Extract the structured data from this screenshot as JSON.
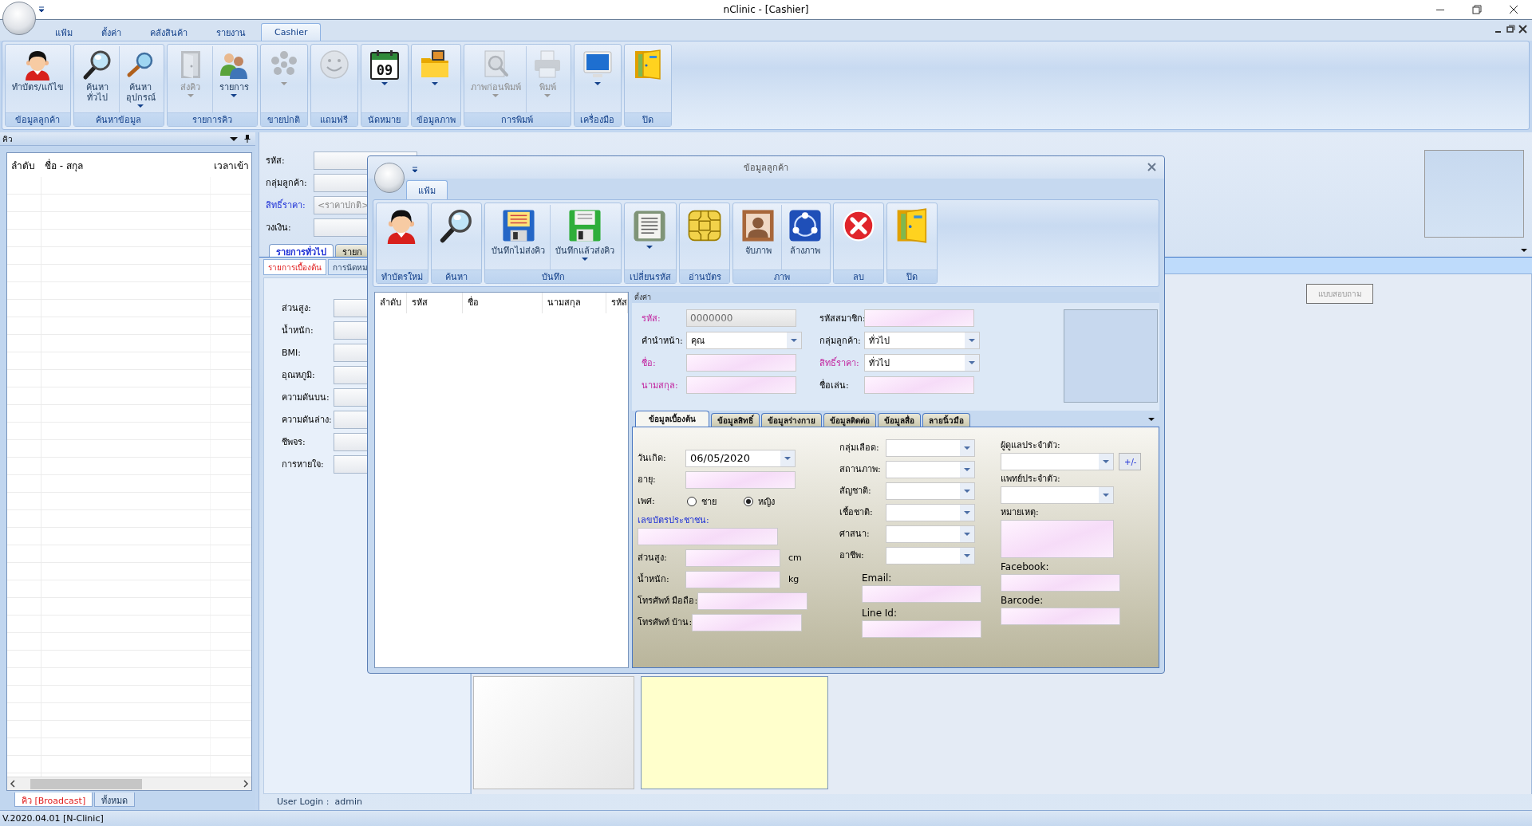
{
  "window": {
    "title": "nClinic - [Cashier]"
  },
  "menu_tabs": [
    {
      "label": "แฟ้ม",
      "selected": false
    },
    {
      "label": "ตั้งค่า",
      "selected": false
    },
    {
      "label": "คลังสินค้า",
      "selected": false
    },
    {
      "label": "รายงาน",
      "selected": false
    },
    {
      "label": "Cashier",
      "selected": true
    }
  ],
  "ribbon": [
    {
      "label": "ข้อมูลลูกค้า",
      "buttons": [
        {
          "kind": "person",
          "label": "ทำบัตร/แก้ไข",
          "disabled": false,
          "dropdown": false
        }
      ]
    },
    {
      "label": "ค้นหาข้อมูล",
      "buttons": [
        {
          "kind": "search",
          "label": "ค้นหา\nทั่วไป",
          "disabled": false,
          "dropdown": false
        },
        {
          "kind": "search_small",
          "label": "ค้นหา\nอุปกรณ์",
          "disabled": false,
          "dropdown": true
        }
      ]
    },
    {
      "label": "รายการคิว",
      "buttons": [
        {
          "kind": "cabinet",
          "label": "ส่งคิว",
          "disabled": true,
          "dropdown": true
        },
        {
          "kind": "people",
          "label": "รายการ",
          "disabled": false,
          "dropdown": true
        }
      ]
    },
    {
      "label": "ขายปกติ",
      "buttons": [
        {
          "kind": "dots",
          "disabled": true,
          "dropdown": true
        }
      ]
    },
    {
      "label": "แถมฟรี",
      "buttons": [
        {
          "kind": "smiley",
          "disabled": true,
          "dropdown": false
        }
      ]
    },
    {
      "label": "นัดหมาย",
      "buttons": [
        {
          "kind": "calendar",
          "day": "09",
          "disabled": false,
          "dropdown": true
        }
      ]
    },
    {
      "label": "ข้อมูลภาพ",
      "buttons": [
        {
          "kind": "folder",
          "disabled": false,
          "dropdown": true
        }
      ]
    },
    {
      "label": "การพิมพ์",
      "buttons": [
        {
          "kind": "preview",
          "label": "ภาพก่อนพิมพ์",
          "disabled": true,
          "dropdown": true
        },
        {
          "kind": "printer",
          "label": "พิมพ์",
          "disabled": true,
          "dropdown": true
        }
      ]
    },
    {
      "label": "เครื่องมือ",
      "buttons": [
        {
          "kind": "monitor",
          "disabled": false,
          "dropdown": true
        }
      ]
    },
    {
      "label": "ปิด",
      "buttons": [
        {
          "kind": "exit",
          "disabled": false,
          "dropdown": false
        }
      ]
    }
  ],
  "queue_panel": {
    "title": "คิว",
    "columns": [
      "ลำดับ",
      "ชื่อ - สกุล",
      "เวลาเข้า"
    ],
    "tabs": [
      {
        "label": "คิว [Broadcast]",
        "selected": true
      },
      {
        "label": "ทั้งหมด",
        "selected": false
      }
    ]
  },
  "customer_form": {
    "fields": [
      {
        "label": "รหัส:",
        "link": false
      },
      {
        "label": "กลุ่มลูกค้า:",
        "link": false
      },
      {
        "label": "สิทธิ์ราคา:",
        "link": true,
        "placeholder": "<ราคาปกติ>"
      },
      {
        "label": "วงเงิน:",
        "link": false
      }
    ]
  },
  "main_tabs": [
    {
      "label": "รายการทั่วไป",
      "selected": true
    },
    {
      "label": "รายก",
      "selected": false
    }
  ],
  "sub_tabs": [
    {
      "label": "รายการเบื้องต้น",
      "selected": true
    },
    {
      "label": "การนัดหม",
      "selected": false
    }
  ],
  "vitals": [
    "ส่วนสูง:",
    "น้ำหนัก:",
    "BMI:",
    "อุณหภูมิ:",
    "ความดันบน:",
    "ความดันล่าง:",
    "ชีพจร:",
    "การหายใจ:"
  ],
  "questionnaire_button": {
    "label": "แบบสอบถาม",
    "disabled": true
  },
  "user_login": "User Login :  admin",
  "status_bar": "V.2020.04.01 [N-Clinic]",
  "dialog": {
    "title": "ข้อมูลลูกค้า",
    "tabs": [
      {
        "label": "แฟ้ม",
        "selected": true
      }
    ],
    "ribbon": [
      {
        "label": "ทำบัตรใหม่",
        "buttons": [
          {
            "kind": "person",
            "disabled": false,
            "dropdown": false
          }
        ]
      },
      {
        "label": "ค้นหา",
        "buttons": [
          {
            "kind": "search",
            "disabled": false,
            "dropdown": false
          }
        ]
      },
      {
        "label": "บันทึก",
        "buttons": [
          {
            "kind": "floppy_blue",
            "label": "บันทึกไม่ส่งคิว",
            "disabled": false,
            "dropdown": false
          },
          {
            "kind": "floppy_green",
            "label": "บันทึกแล้วส่งคิว",
            "disabled": false,
            "dropdown": true
          }
        ]
      },
      {
        "label": "เปลี่ยนรหัส",
        "buttons": [
          {
            "kind": "document",
            "disabled": false,
            "dropdown": true
          }
        ]
      },
      {
        "label": "อ่านบัตร",
        "buttons": [
          {
            "kind": "chip",
            "disabled": false,
            "dropdown": false
          }
        ]
      },
      {
        "label": "ภาพ",
        "buttons": [
          {
            "kind": "portrait",
            "label": "จับภาพ",
            "disabled": false,
            "dropdown": false
          },
          {
            "kind": "network",
            "label": "ล้างภาพ",
            "disabled": false,
            "dropdown": false
          }
        ]
      },
      {
        "label": "ลบ",
        "buttons": [
          {
            "kind": "delete",
            "disabled": false,
            "dropdown": false
          }
        ]
      },
      {
        "label": "ปิด",
        "buttons": [
          {
            "kind": "exit",
            "disabled": false,
            "dropdown": false
          }
        ]
      }
    ],
    "list_columns": [
      "ลำดับ",
      "รหัส",
      "ชื่อ",
      "นามสกุล",
      "รหัส"
    ],
    "section_title": "ตั้งค่า",
    "fields": [
      {
        "label": "รหัส:",
        "required": true,
        "kind": "text",
        "value": "0000000",
        "disabled": true
      },
      {
        "label": "รหัสสมาชิก:",
        "required": false,
        "kind": "text",
        "disabled": false
      },
      {
        "label": "คำนำหน้า:",
        "required": false,
        "kind": "combo",
        "value": "คุณ",
        "disabled": false
      },
      {
        "label": "กลุ่มลูกค้า:",
        "required": false,
        "kind": "combo",
        "value": "ทั่วไป",
        "disabled": false
      },
      {
        "label": "ชื่อ:",
        "required": true,
        "kind": "text",
        "disabled": false
      },
      {
        "label": "สิทธิ์ราคา:",
        "required": true,
        "kind": "combo",
        "value": "ทั่วไป",
        "disabled": false
      },
      {
        "label": "นามสกุล:",
        "required": true,
        "kind": "text",
        "disabled": false
      },
      {
        "label": "ชื่อเล่น:",
        "required": false,
        "kind": "text",
        "disabled": false
      }
    ],
    "detail_tabs": [
      {
        "label": "ข้อมูลเบื้องต้น",
        "selected": true
      },
      {
        "label": "ข้อมูลสิทธิ์",
        "selected": false
      },
      {
        "label": "ข้อมูลร่างกาย",
        "selected": false
      },
      {
        "label": "ข้อมูลติดต่อ",
        "selected": false
      },
      {
        "label": "ข้อมูลสื่อ",
        "selected": false
      },
      {
        "label": "ลายนิ้วมือ",
        "selected": false
      }
    ],
    "detail_columns": [
      [
        {
          "label": "วันเกิด:",
          "kind": "date",
          "value": "06/05/2020",
          "link": false,
          "label_above": false
        },
        {
          "label": "อายุ:",
          "kind": "text",
          "link": false,
          "label_above": false
        },
        {
          "label": "เพศ:",
          "kind": "radio",
          "link": false,
          "label_above": false,
          "options": [
            {
              "label": "ชาย",
              "selected": false
            },
            {
              "label": "หญิง",
              "selected": true
            }
          ]
        },
        {
          "label": "เลขบัตรประชาชน:",
          "kind": "text",
          "link": true,
          "label_above": true
        },
        {
          "label": "ส่วนสูง:",
          "kind": "text",
          "link": false,
          "label_above": false,
          "unit": "cm"
        },
        {
          "label": "น้ำหนัก:",
          "kind": "text",
          "link": false,
          "label_above": false,
          "unit": "kg"
        },
        {
          "label": "โทรศัพท์ มือถือ:",
          "kind": "text",
          "link": false,
          "label_above": false
        },
        {
          "label": "โทรศัพท์ บ้าน:",
          "kind": "text",
          "link": false,
          "label_above": false
        }
      ],
      [
        {
          "label": "กลุ่มเลือด:",
          "kind": "combo",
          "link": false,
          "label_above": false
        },
        {
          "label": "สถานภาพ:",
          "kind": "combo",
          "link": false,
          "label_above": false
        },
        {
          "label": "สัญชาติ:",
          "kind": "combo",
          "link": false,
          "label_above": false
        },
        {
          "label": "เชื้อชาติ:",
          "kind": "combo",
          "link": false,
          "label_above": false
        },
        {
          "label": "ศาสนา:",
          "kind": "combo",
          "link": false,
          "label_above": false
        },
        {
          "label": "อาชีพ:",
          "kind": "combo",
          "link": false,
          "label_above": false
        },
        {
          "label": "Email:",
          "kind": "text",
          "link": false,
          "label_above": true
        },
        {
          "label": "Line Id:",
          "kind": "text",
          "link": false,
          "label_above": true
        }
      ],
      [
        {
          "label": "ผู้ดูแลประจำตัว:",
          "kind": "combo",
          "link": false,
          "label_above": true,
          "button": "+/-"
        },
        {
          "label": "แพทย์ประจำตัว:",
          "kind": "combo",
          "link": false,
          "label_above": true
        },
        {
          "label": "หมายเหตุ:",
          "kind": "textarea",
          "link": false,
          "label_above": true
        },
        {
          "label": "Facebook:",
          "kind": "text",
          "link": false,
          "label_above": true
        },
        {
          "label": "Barcode:",
          "kind": "text",
          "link": false,
          "label_above": true
        }
      ]
    ]
  }
}
